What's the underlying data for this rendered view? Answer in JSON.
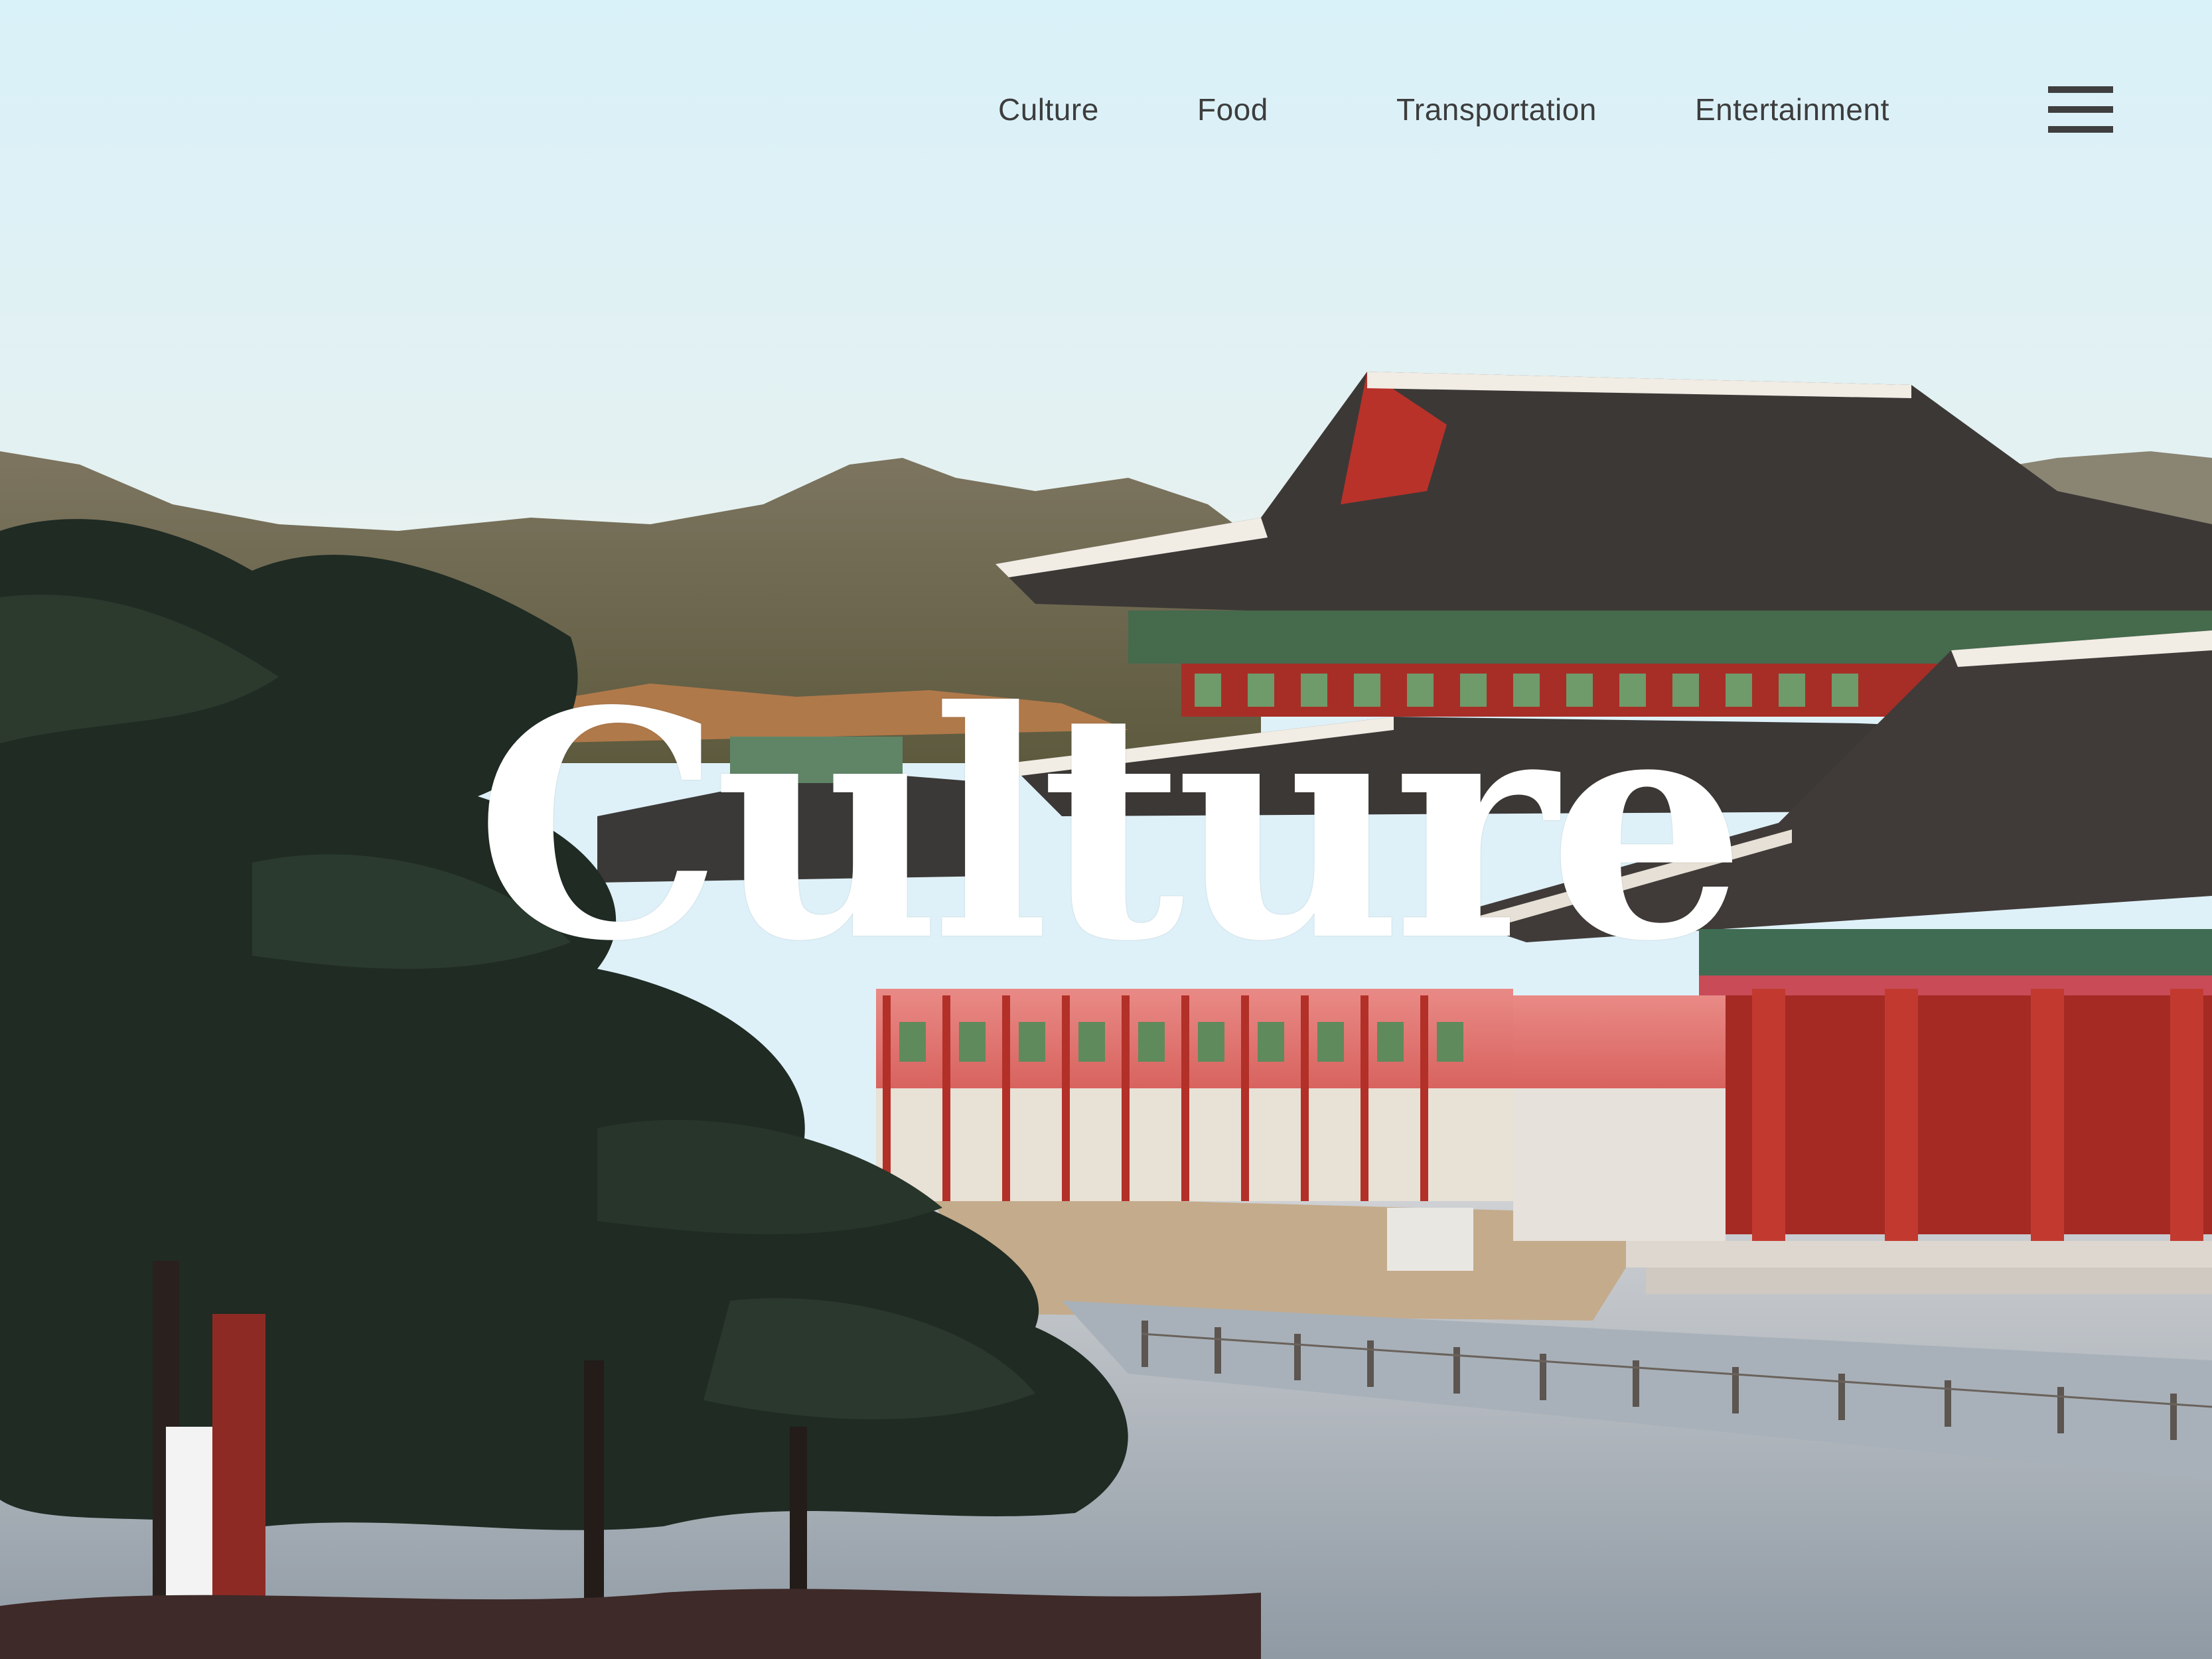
{
  "nav": {
    "items": [
      {
        "label": "Culture"
      },
      {
        "label": "Food"
      },
      {
        "label": "Transportation"
      },
      {
        "label": "Entertainment"
      }
    ],
    "menu_icon": "hamburger-menu-icon"
  },
  "hero": {
    "title": "Culture",
    "photo": "gyeongbokgung-palace-photo"
  },
  "colors": {
    "sky": "#dff1f8",
    "nav_text": "#3d3d3d",
    "title_text": "#ffffff",
    "palace_red": "#b8322a",
    "roof_dark": "#3a3634",
    "pine_dark": "#1d2a22",
    "mountain": "#6e6a4c"
  }
}
